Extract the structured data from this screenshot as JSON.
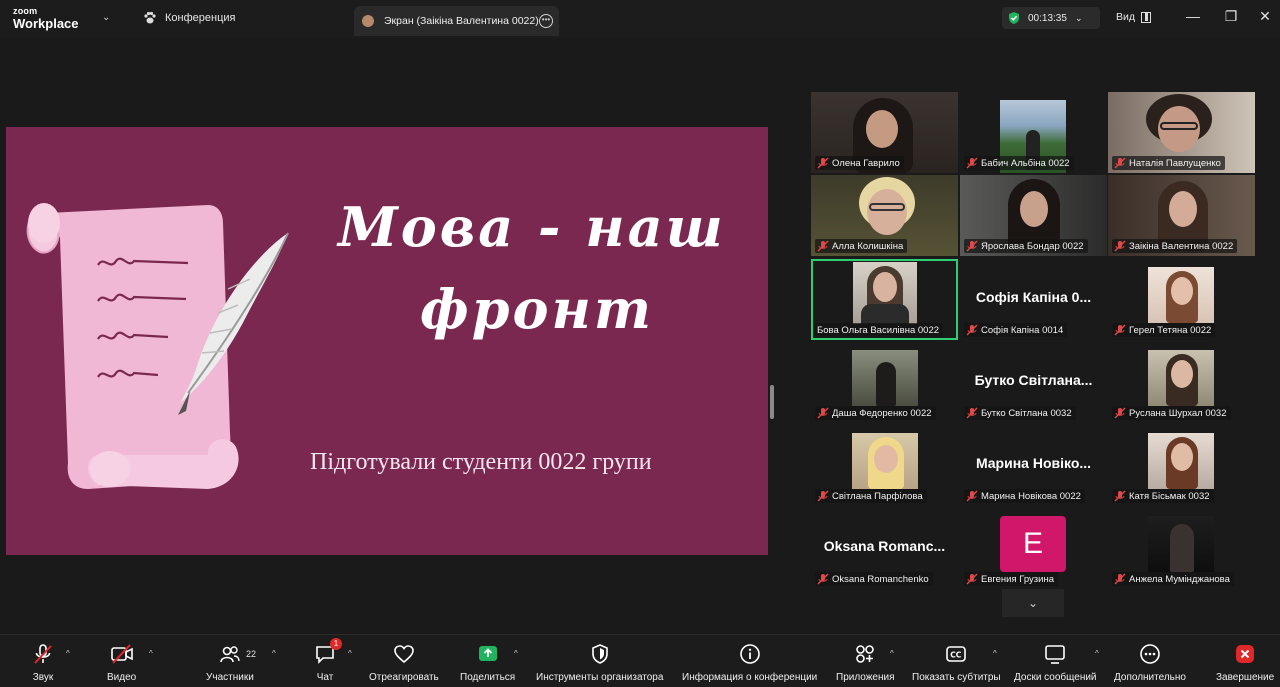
{
  "titlebar": {
    "logo_small": "zoom",
    "logo_big": "Workplace",
    "conference_label": "Конференция",
    "screen_tab_label": "Экран (Заікіна Валентина 0022)",
    "timer": "00:13:35",
    "view_label": "Вид",
    "minimize": "—",
    "restore": "❐",
    "close": "✕"
  },
  "slide": {
    "title_line1": "Мова - наш",
    "title_line2": "фронт",
    "subtitle": "Підготували студенти 0022 групи",
    "bg_color": "#7b2850"
  },
  "gallery": {
    "tiles": [
      {
        "name": "Олена Гаврило"
      },
      {
        "name": "Бабич Альбіна 0022"
      },
      {
        "name": "Наталія Павлущенко"
      },
      {
        "name": "Алла Колишкіна"
      },
      {
        "name": "Ярослава Бондар 0022"
      },
      {
        "name": "Заікіна Валентина 0022"
      },
      {
        "name": "Бова Ольга Василівна  0022"
      },
      {
        "name": "Софія Капіна 0014",
        "display": "Софія Капіна 0..."
      },
      {
        "name": "Герел Тетяна  0022"
      },
      {
        "name": "Даша Федоренко 0022"
      },
      {
        "name": "Бутко Світлана 0032",
        "display": "Бутко Світлана..."
      },
      {
        "name": "Руслана Шурхал 0032"
      },
      {
        "name": "Світлана Парфілова"
      },
      {
        "name": "Марина Новікова 0022",
        "display": "Марина Новіко..."
      },
      {
        "name": "Катя Бісьмак 0032"
      },
      {
        "name": "Oksana Romanchenko",
        "display": "Oksana Romanc..."
      },
      {
        "name": "Евгения Грузина",
        "avatar_letter": "E"
      },
      {
        "name": "Анжела Мумінджанова"
      }
    ],
    "scroll_down": "⌄"
  },
  "toolbar": {
    "audio": "Звук",
    "video": "Видео",
    "participants": "Участники",
    "participants_count": "22",
    "chat": "Чат",
    "chat_badge": "1",
    "react": "Отреагировать",
    "share": "Поделиться",
    "host_tools": "Инструменты организатора",
    "meeting_info": "Информация о конференции",
    "apps": "Приложения",
    "captions": "Показать субтитры",
    "whiteboards": "Доски сообщений",
    "more": "Дополнительно",
    "end": "Завершение"
  },
  "colors": {
    "accent_green": "#2fce72",
    "end_red": "#e02828",
    "avatar_pink": "#d0176a"
  }
}
